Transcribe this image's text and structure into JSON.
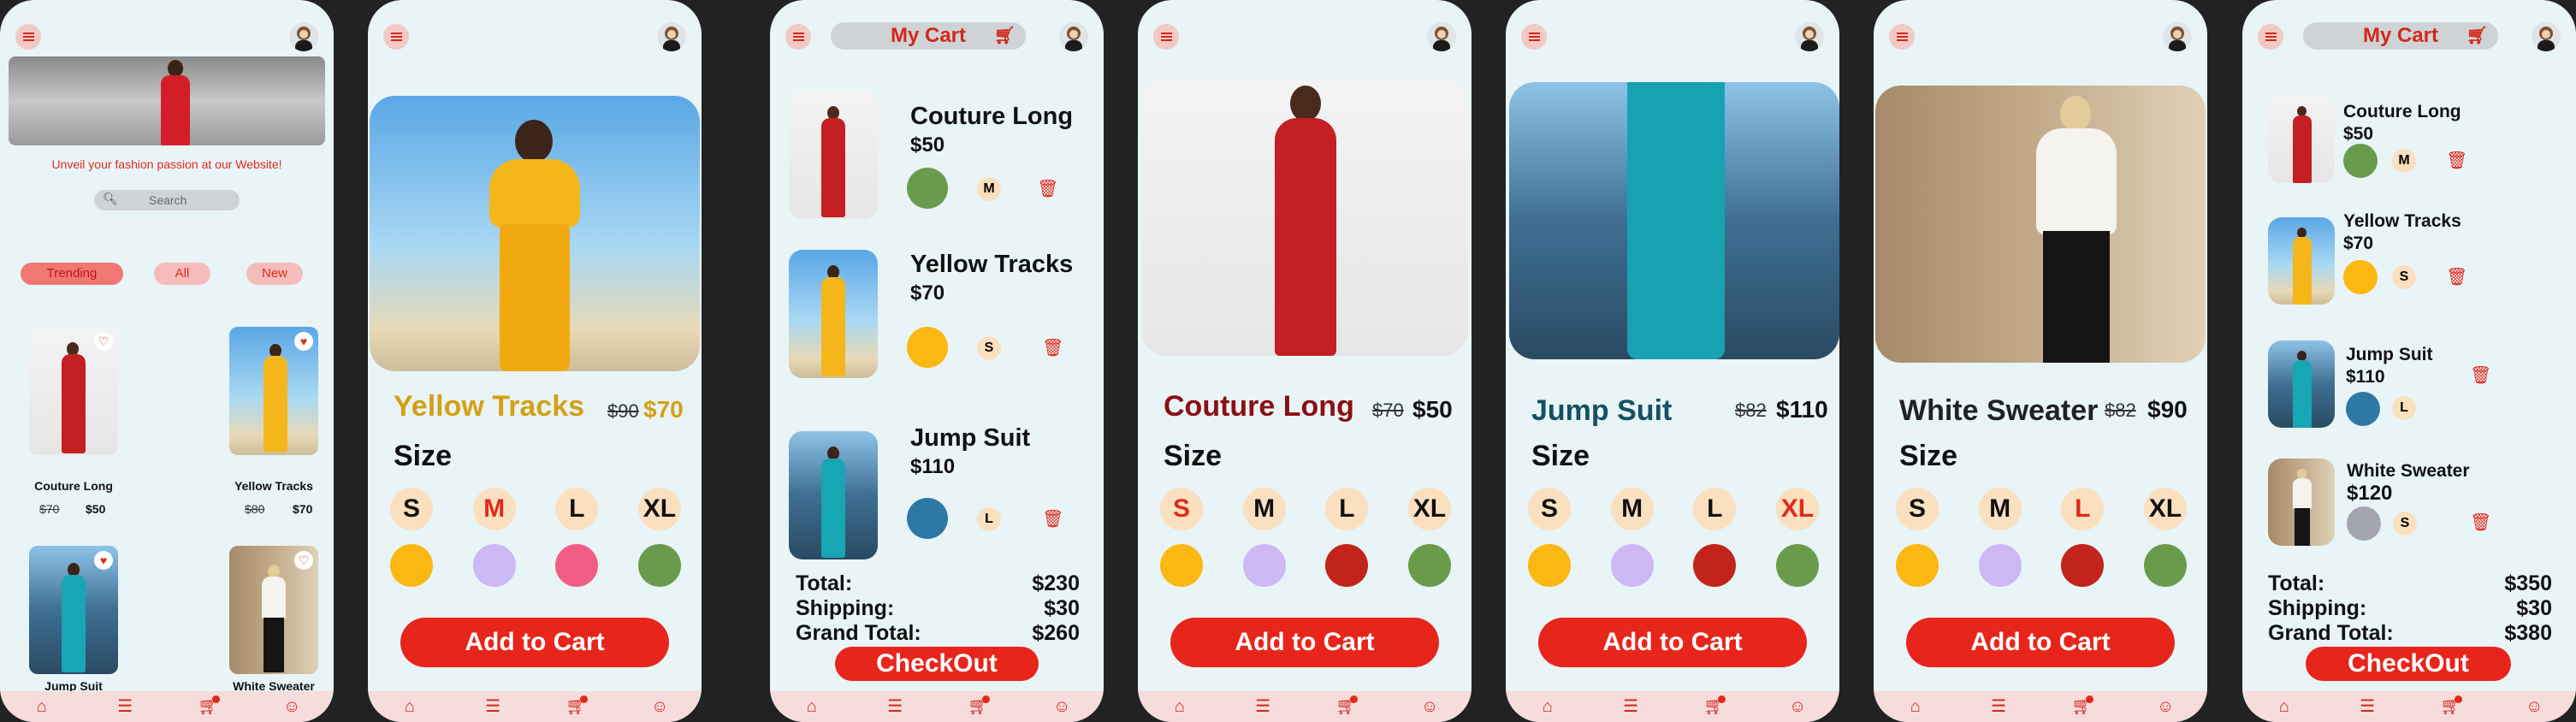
{
  "home": {
    "banner_text": "Unveil your fashion passion at our Website!",
    "search_placeholder": "Search",
    "tags": [
      "Trending",
      "All",
      "New"
    ],
    "products": [
      {
        "name": "Couture Long",
        "old_price": "$70",
        "price": "$50"
      },
      {
        "name": "Yellow Tracks",
        "old_price": "$80",
        "price": "$70"
      },
      {
        "name": "Jump Suit",
        "old_price": "",
        "price": ""
      },
      {
        "name": "White Sweater",
        "old_price": "",
        "price": ""
      }
    ]
  },
  "sizes": [
    "S",
    "M",
    "L",
    "XL"
  ],
  "add_to_cart_label": "Add to Cart",
  "details": [
    {
      "title": "Yellow Tracks",
      "old_price": "$90",
      "price": "$70",
      "size_label": "Size",
      "selected_size": "M",
      "title_color": "#d4a017",
      "colors": [
        "#fbb812",
        "#cbb8f5",
        "#f25d86",
        "#6a9b4d"
      ]
    },
    {
      "title": "Couture Long",
      "old_price": "$70",
      "price": "$50",
      "size_label": "Size",
      "selected_size": "S",
      "title_color": "#8b0f12",
      "colors": [
        "#fbb812",
        "#cbb8f5",
        "#c2241c",
        "#6a9b4d"
      ]
    },
    {
      "title": "Jump Suit",
      "old_price": "$82",
      "price": "$110",
      "size_label": "Size",
      "selected_size": "XL",
      "title_color": "#135163",
      "colors": [
        "#fbb812",
        "#cbb8f5",
        "#c2241c",
        "#6a9b4d"
      ]
    },
    {
      "title": "White Sweater",
      "old_price": "$82",
      "price": "$90",
      "size_label": "Size",
      "selected_size": "L",
      "title_color": "#222222",
      "colors": [
        "#fbb812",
        "#cbb8f5",
        "#c2241c",
        "#6a9b4d"
      ]
    }
  ],
  "cart1": {
    "title": "My Cart",
    "items": [
      {
        "name": "Couture Long",
        "price": "$50",
        "size": "M",
        "color": "#6a9b4d"
      },
      {
        "name": "Yellow Tracks",
        "price": "$70",
        "size": "S",
        "color": "#fbb812"
      },
      {
        "name": "Jump Suit",
        "price": "$110",
        "size": "L",
        "color": "#2e78a6"
      }
    ],
    "totals": [
      {
        "label": "Total:",
        "value": "$230"
      },
      {
        "label": "Shipping:",
        "value": "$30"
      },
      {
        "label": "Grand Total:",
        "value": "$260"
      }
    ],
    "checkout_label": "CheckOut"
  },
  "cart2": {
    "title": "My Cart",
    "items": [
      {
        "name": "Couture Long",
        "price": "$50",
        "size": "M",
        "color": "#6a9b4d"
      },
      {
        "name": "Yellow Tracks",
        "price": "$70",
        "size": "S",
        "color": "#fbb812"
      },
      {
        "name": "Jump Suit",
        "price": "$110",
        "size": "L",
        "color": "#2e78a6"
      },
      {
        "name": "White Sweater",
        "price": "$120",
        "size": "S",
        "color": "#a3a6b0"
      }
    ],
    "totals": [
      {
        "label": "Total:",
        "value": "$350"
      },
      {
        "label": "Shipping:",
        "value": "$30"
      },
      {
        "label": "Grand Total:",
        "value": "$380"
      }
    ],
    "checkout_label": "CheckOut"
  },
  "icons": {
    "menu": "hamburger-menu-icon",
    "cart": "shopping-cart-icon",
    "home": "home-icon",
    "list": "list-icon",
    "profile": "profile-icon",
    "heart": "heart-icon",
    "delete": "trash-icon",
    "search": "search-icon"
  },
  "accent_color": "#e8251a"
}
